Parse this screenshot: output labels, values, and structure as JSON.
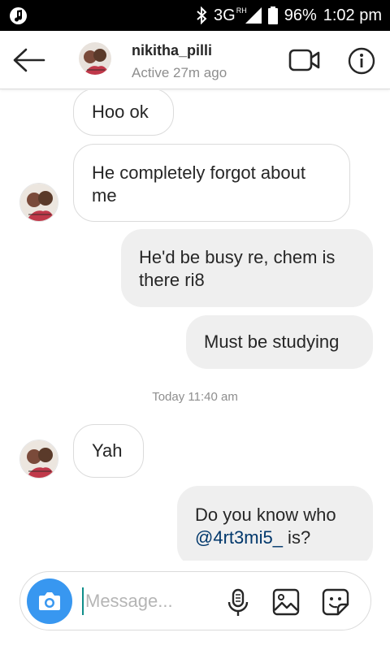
{
  "status_bar": {
    "network": "3G",
    "network_sup": "RH",
    "battery": "96%",
    "time": "1:02 pm"
  },
  "header": {
    "username": "nikitha_pilli",
    "active_status": "Active 27m ago"
  },
  "messages": {
    "m1": "Hoo ok",
    "m2_line1": "He completely forgot about",
    "m2_line2": "me",
    "m3_line1": "He'd be busy re, chem is",
    "m3_line2": "there ri8",
    "m4": "Must be studying",
    "timestamp": "Today 11:40 am",
    "m5": "Yah",
    "m6_line1": "Do you know who",
    "m6_mention": "@4rt3mi5_",
    "m6_tail": " is?"
  },
  "composer": {
    "placeholder": "Message..."
  },
  "colors": {
    "accent": "#3897f0",
    "mention": "#00376b",
    "outgoing_bubble": "#efefef"
  },
  "icons": [
    "back-arrow-icon",
    "video-call-icon",
    "info-icon",
    "camera-icon",
    "microphone-icon",
    "gallery-icon",
    "sticker-icon"
  ]
}
